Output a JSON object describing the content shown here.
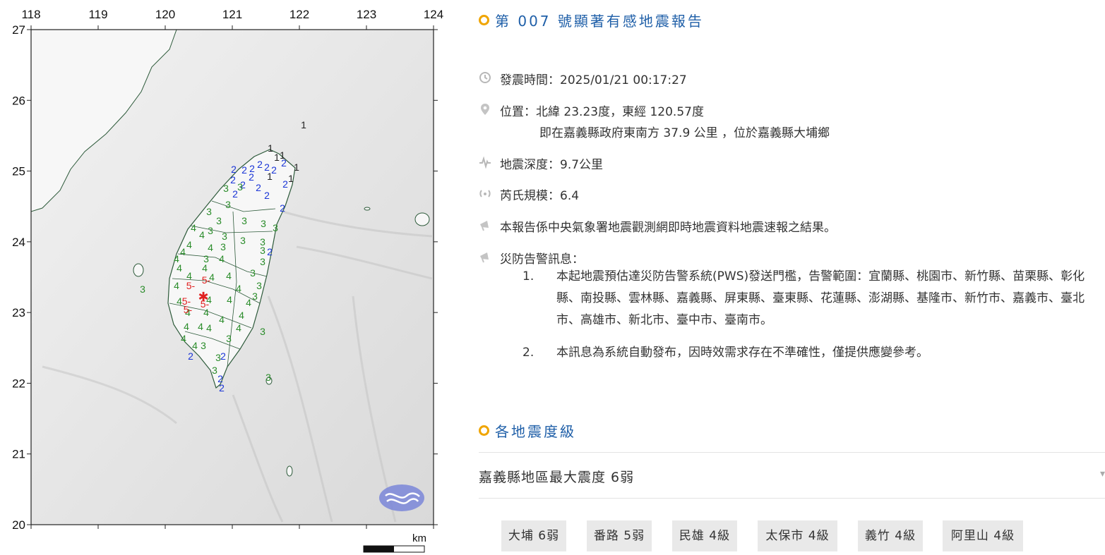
{
  "map": {
    "lon_labels": [
      "118",
      "119",
      "120",
      "121",
      "122",
      "123",
      "124"
    ],
    "lat_labels": [
      "27",
      "26",
      "25",
      "24",
      "23",
      "22",
      "21",
      "20"
    ],
    "scale_unit": "km",
    "epicenter_symbol": "star",
    "colors": {
      "level1": "#222222",
      "level2": "#1a35d6",
      "level3": "#2a8c2a",
      "level4": "#2a8c2a",
      "level5": "#e02020",
      "epicenter": "#e02020"
    }
  },
  "report": {
    "title": "第 007 號顯著有感地震報告",
    "time_label": "發震時間：2025/01/21 00:17:27",
    "location_label": "位置：北緯 23.23度，東經 120.57度",
    "location_detail": "即在嘉義縣政府東南方 37.9 公里 ，位於嘉義縣大埔鄉",
    "depth_label": "地震深度：9.7公里",
    "magnitude_label": "芮氏規模：6.4",
    "source_note": "本報告係中央氣象署地震觀測網即時地震資料地震速報之結果。",
    "warning_title": "災防告警訊息：",
    "warnings": [
      {
        "num": "1.",
        "text": "本起地震預估達災防告警系統(PWS)發送門檻，告警範圍：宜蘭縣、桃園市、新竹縣、苗栗縣、彰化縣、南投縣、雲林縣、嘉義縣、屏東縣、臺東縣、花蓮縣、澎湖縣、基隆市、新竹市、嘉義市、臺北市、高雄市、新北市、臺中市、臺南市。"
      },
      {
        "num": "2.",
        "text": "本訊息為系統自動發布，因時效需求存在不準確性，僅提供應變參考。"
      }
    ],
    "icons": [
      "clock-icon",
      "pin-icon",
      "pulse-icon",
      "signal-icon",
      "megaphone-icon",
      "megaphone-icon"
    ]
  },
  "intensity": {
    "title": "各地震度級",
    "summary": "嘉義縣地區最大震度 6弱",
    "stations": [
      "大埔 6弱",
      "番路 5弱",
      "民雄 4級",
      "太保市 4級",
      "義竹 4級",
      "阿里山 4級"
    ]
  }
}
